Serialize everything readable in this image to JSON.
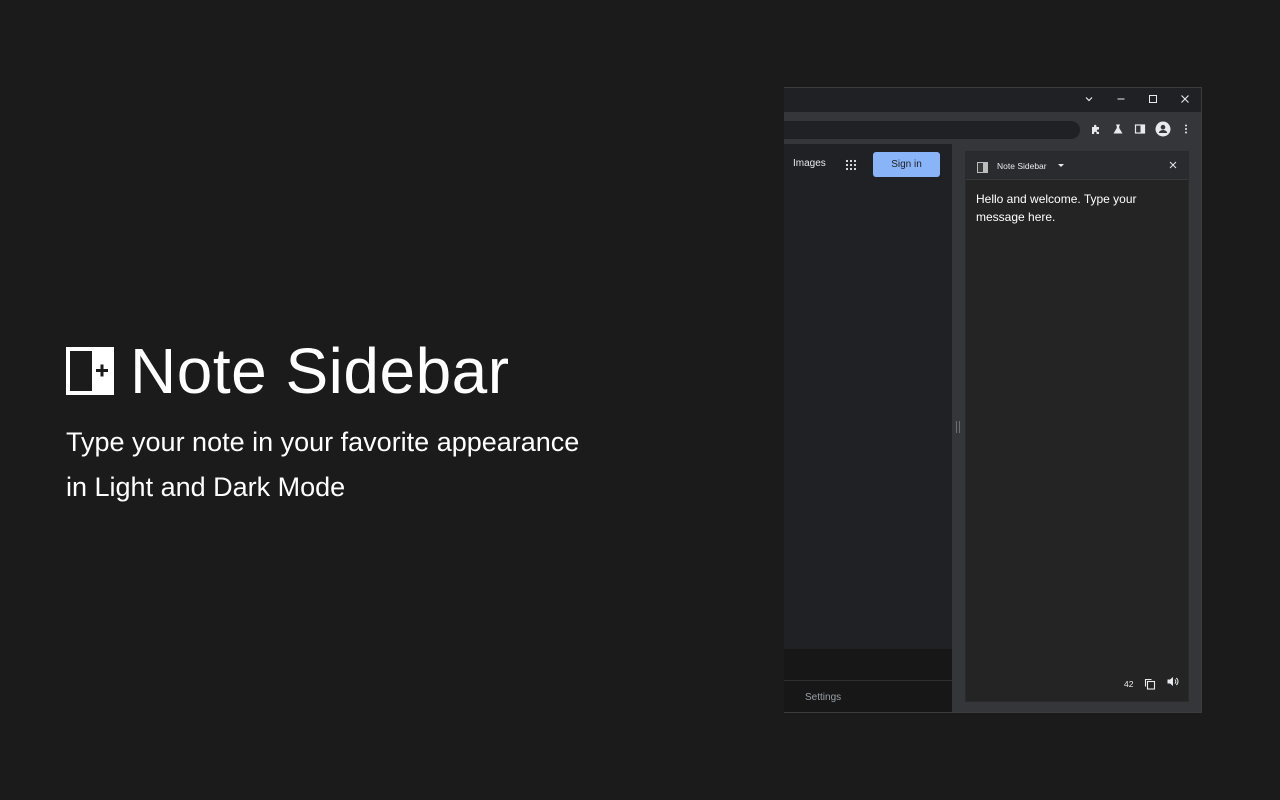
{
  "promo": {
    "title": "Note Sidebar",
    "tagline_line1": "Type your note in your favorite appearance",
    "tagline_line2": "in Light and Dark Mode"
  },
  "browser": {
    "window_controls": [
      "chevron-down-icon",
      "minimize-icon",
      "maximize-icon",
      "close-icon"
    ],
    "toolbar_icons": [
      "extensions-icon",
      "labs-icon",
      "side-panel-icon",
      "profile-icon",
      "more-icon"
    ],
    "page": {
      "images_link": "Images",
      "signin_label": "Sign in",
      "settings_link": "Settings"
    },
    "side_panel": {
      "title": "Note Sidebar",
      "note_text": "Hello and welcome. Type your message here.",
      "char_count": "42"
    }
  },
  "colors": {
    "background": "#1b1b1b",
    "accent": "#8ab4f8",
    "panel": "#242424"
  }
}
